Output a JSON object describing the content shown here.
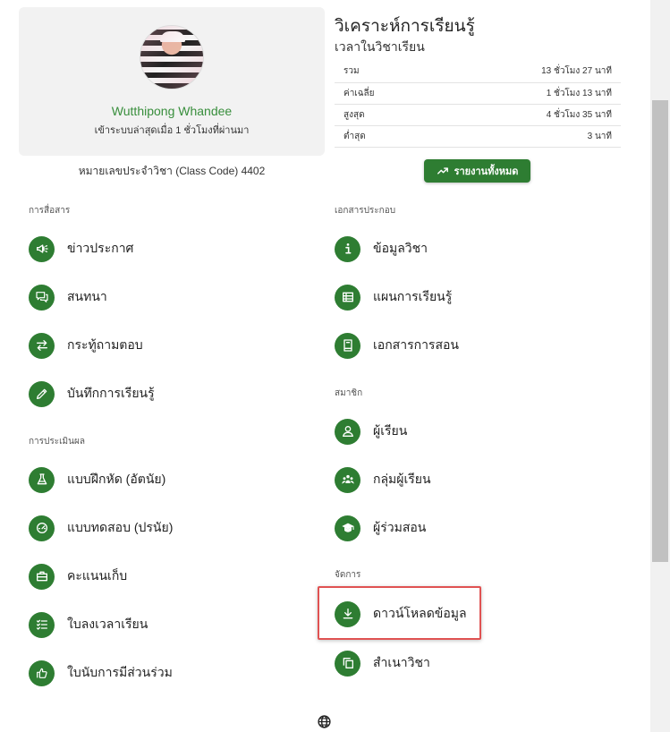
{
  "profile": {
    "name": "Wutthipong Whandee",
    "last_seen": "เข้าระบบล่าสุดเมื่อ 1 ชั่วโมงที่ผ่านมา",
    "class_code": "หมายเลขประจำวิชา (Class Code) 4402"
  },
  "analysis": {
    "title": "วิเคราะห์การเรียนรู้",
    "subtitle": "เวลาในวิชาเรียน",
    "rows": [
      {
        "label": "รวม",
        "value": "13 ชั่วโมง 27 นาที"
      },
      {
        "label": "ค่าเฉลี่ย",
        "value": "1 ชั่วโมง 13 นาที"
      },
      {
        "label": "สูงสุด",
        "value": "4 ชั่วโมง 35 นาที"
      },
      {
        "label": "ต่ำสุด",
        "value": "3 นาที"
      }
    ],
    "report_button": "รายงานทั้งหมด"
  },
  "sections": {
    "communication": {
      "header": "การสื่อสาร",
      "items": [
        {
          "label": "ข่าวประกาศ",
          "icon": "megaphone-icon"
        },
        {
          "label": "สนทนา",
          "icon": "chat-icon"
        },
        {
          "label": "กระทู้ถามตอบ",
          "icon": "swap-arrows-icon"
        },
        {
          "label": "บันทึกการเรียนรู้",
          "icon": "pencil-icon"
        }
      ]
    },
    "assessment": {
      "header": "การประเมินผล",
      "items": [
        {
          "label": "แบบฝึกหัด (อัตนัย)",
          "icon": "flask-icon"
        },
        {
          "label": "แบบทดสอบ (ปรนัย)",
          "icon": "gauge-icon"
        },
        {
          "label": "คะแนนเก็บ",
          "icon": "briefcase-icon"
        },
        {
          "label": "ใบลงเวลาเรียน",
          "icon": "checklist-icon"
        },
        {
          "label": "ใบนับการมีส่วนร่วม",
          "icon": "thumb-hand-icon"
        }
      ]
    },
    "documents": {
      "header": "เอกสารประกอบ",
      "items": [
        {
          "label": "ข้อมูลวิชา",
          "icon": "info-icon"
        },
        {
          "label": "แผนการเรียนรู้",
          "icon": "list-table-icon"
        },
        {
          "label": "เอกสารการสอน",
          "icon": "book-icon"
        }
      ]
    },
    "members": {
      "header": "สมาชิก",
      "items": [
        {
          "label": "ผู้เรียน",
          "icon": "person-icon"
        },
        {
          "label": "กลุ่มผู้เรียน",
          "icon": "group-icon"
        },
        {
          "label": "ผู้ร่วมสอน",
          "icon": "graduation-cap-icon"
        }
      ]
    },
    "manage": {
      "header": "จัดการ",
      "items": [
        {
          "label": "ดาวน์โหลดข้อมูล",
          "icon": "download-icon"
        },
        {
          "label": "สำเนาวิชา",
          "icon": "copy-icon"
        }
      ]
    }
  },
  "colors": {
    "accent": "#2e7d32",
    "name_text": "#388e3c",
    "highlight": "#e05252"
  }
}
